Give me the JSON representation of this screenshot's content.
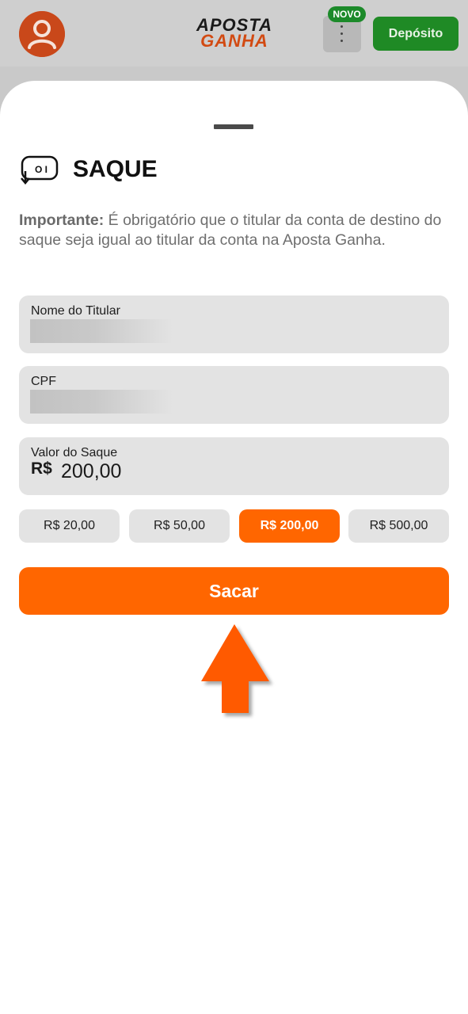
{
  "header": {
    "logo_line1": "APOSTA",
    "logo_line2": "GANHA",
    "new_badge": "NOVO",
    "deposit_label": "Depósito"
  },
  "sheet": {
    "title": "SAQUE",
    "info_bold": "Importante:",
    "info_text": " É obrigatório que o titular da conta de destino do saque seja igual ao titular da conta na Aposta Ganha.",
    "fields": [
      {
        "label": "Nome do Titular"
      },
      {
        "label": "CPF"
      },
      {
        "label": "Valor do Saque",
        "prefix": "R$",
        "value": "200,00"
      }
    ],
    "amount_options": [
      "R$ 20,00",
      "R$ 50,00",
      "R$ 200,00",
      "R$ 500,00"
    ],
    "selected_option_index": 2,
    "submit_label": "Sacar"
  },
  "colors": {
    "accent": "#ff6600",
    "deposit_green": "#1f8a25",
    "field_bg": "#e3e3e3"
  },
  "icons": [
    "user-icon",
    "more-vertical-icon",
    "withdraw-icon",
    "pointer-arrow-icon"
  ]
}
